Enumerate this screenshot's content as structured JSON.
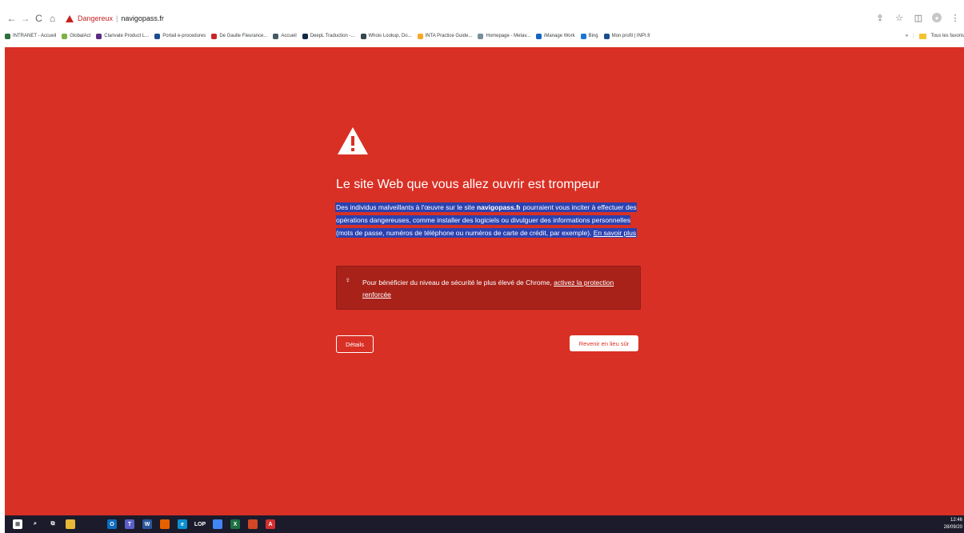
{
  "browser": {
    "nav": {
      "back": "←",
      "forward": "→",
      "reload": "C",
      "home": "⌂"
    },
    "omnibox": {
      "security_label": "Dangereux",
      "separator": "|",
      "url": "navigopass.fr"
    },
    "right_icons": [
      "share-icon",
      "star-icon",
      "sidepanel-icon",
      "profile-icon",
      "menu-icon"
    ],
    "bookmarks": [
      {
        "label": "INTRANET - Accueil",
        "color": "#2f6f3e"
      },
      {
        "label": "GlobalAct",
        "color": "#7cb342"
      },
      {
        "label": "Clarivate Product L...",
        "color": "#5b2c83"
      },
      {
        "label": "Portail e-procedures",
        "color": "#1a4d8f"
      },
      {
        "label": "De Gaulle Fleurance...",
        "color": "#c62828"
      },
      {
        "label": "Accueil",
        "color": "#455a64"
      },
      {
        "label": "DeepL Traduction -...",
        "color": "#0f2b46"
      },
      {
        "label": "Whois Lookup, Do...",
        "color": "#37474f"
      },
      {
        "label": "INTA Practice Guide...",
        "color": "#f9a825"
      },
      {
        "label": "Homepage - Metav...",
        "color": "#78909c"
      },
      {
        "label": "iManage Work",
        "color": "#1565c0"
      },
      {
        "label": "Bing",
        "color": "#1976d2"
      },
      {
        "label": "Mon profil | INPI.fr",
        "color": "#1a4d8f"
      }
    ],
    "bookmarks_overflow": "»",
    "all_bookmarks": "Tous les favoris"
  },
  "interstitial": {
    "heading": "Le site Web que vous allez ouvrir est trompeur",
    "desc_pre": "Des individus malveillants à l'œuvre sur le site ",
    "desc_site": "navigopass.fr",
    "desc_post": " pourraient vous inciter à effectuer des opérations dangereuses, comme installer des logiciels ou divulguer des informations personnelles (mots de passe, numéros de téléphone ou numéros de carte de crédit, par exemple). ",
    "learn_more": "En savoir plus",
    "info_pre": "Pour bénéficier du niveau de sécurité le plus élevé de Chrome, ",
    "info_link": "activez la protection renforcée",
    "details_button": "Détails",
    "back_button": "Revenir en lieu sûr",
    "colors": {
      "background": "#d93025",
      "info_box": "#a8221a",
      "selection": "#2b41b0"
    }
  },
  "taskbar": {
    "apps": [
      {
        "name": "windows-icon",
        "color": "#ffffff",
        "glyph": "⊞"
      },
      {
        "name": "search-icon",
        "color": "transparent",
        "glyph": "⌕"
      },
      {
        "name": "taskview-icon",
        "color": "transparent",
        "glyph": "⧉"
      },
      {
        "name": "file-explorer-icon",
        "color": "#e8b73a",
        "glyph": ""
      },
      {
        "name": "outlook-icon",
        "color": "#0f6cbd",
        "glyph": "O"
      },
      {
        "name": "teams-icon",
        "color": "#5b5fc7",
        "glyph": "T"
      },
      {
        "name": "word-icon",
        "color": "#2b579a",
        "glyph": "W"
      },
      {
        "name": "firefox-icon",
        "color": "#e66000",
        "glyph": ""
      },
      {
        "name": "edge-icon",
        "color": "#0c8fd1",
        "glyph": "e"
      },
      {
        "name": "lop-icon",
        "color": "transparent",
        "glyph": "LOP"
      },
      {
        "name": "chrome-icon",
        "color": "#4285f4",
        "glyph": ""
      },
      {
        "name": "excel-icon",
        "color": "#1d6f42",
        "glyph": "X"
      },
      {
        "name": "powerpoint-icon",
        "color": "#d24726",
        "glyph": ""
      },
      {
        "name": "acrobat-icon",
        "color": "#d32f2f",
        "glyph": "A"
      }
    ],
    "time": "12:46",
    "date": "28/09/20"
  }
}
